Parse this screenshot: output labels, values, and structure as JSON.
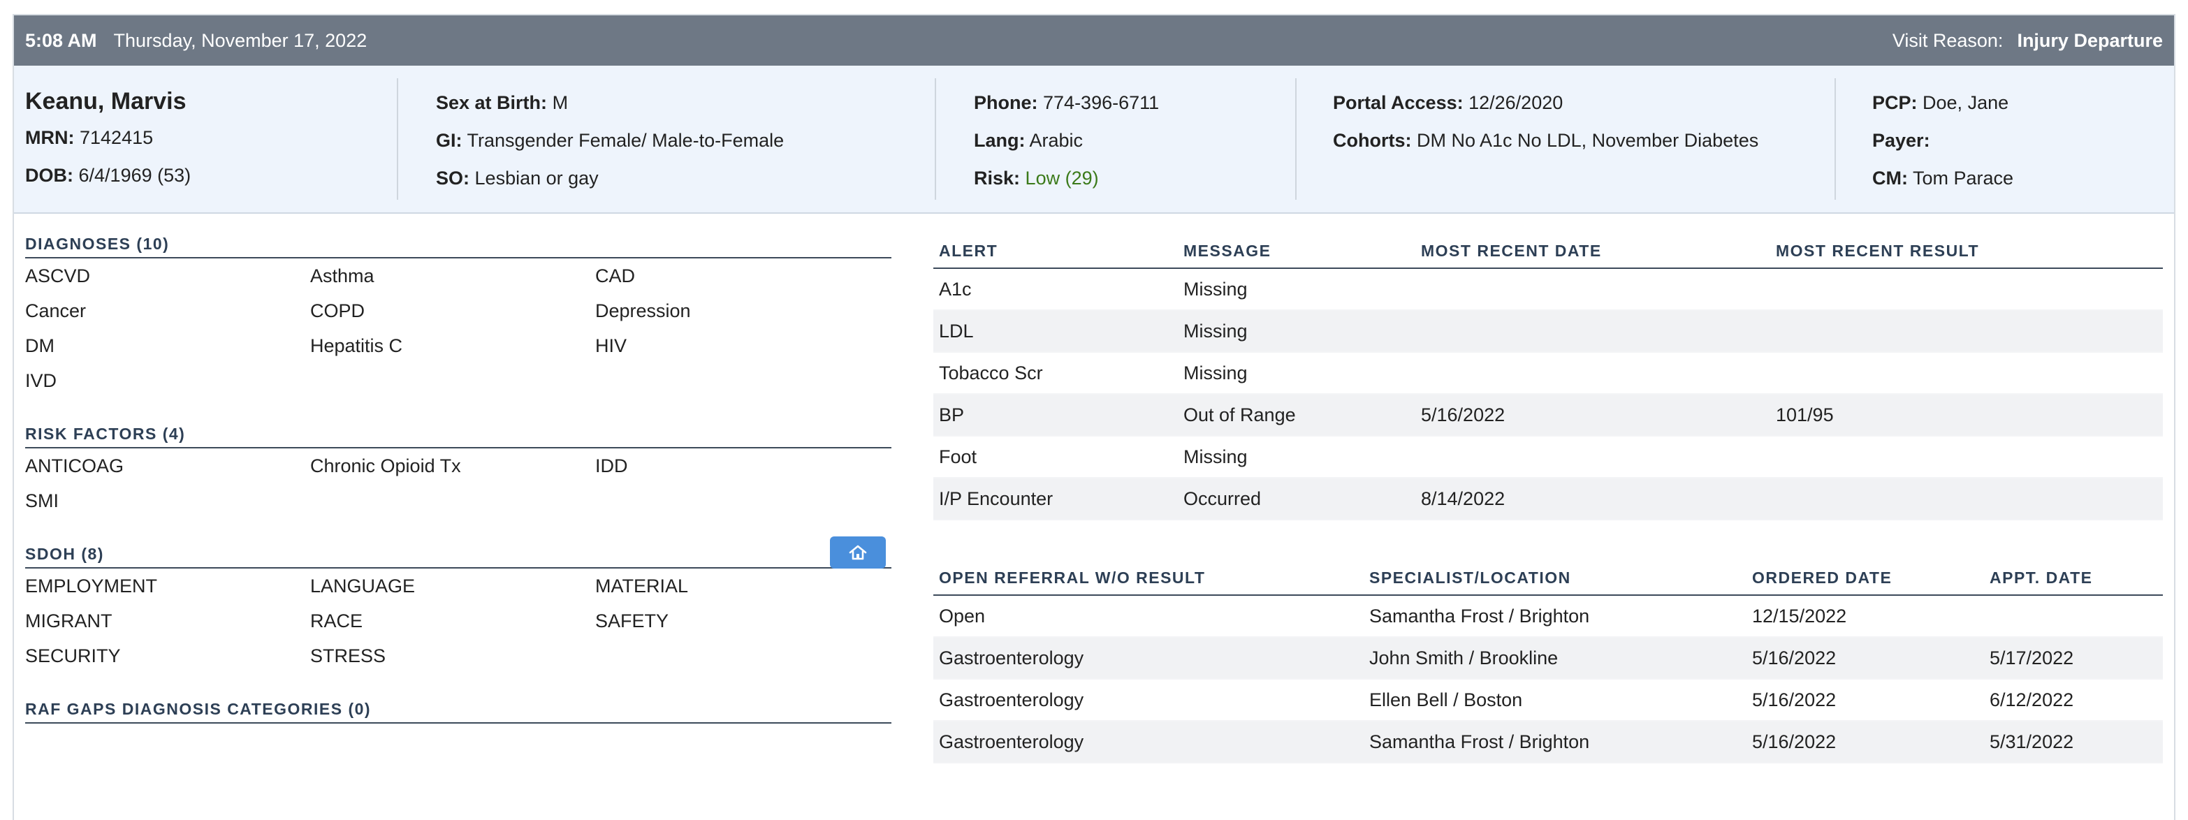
{
  "topbar": {
    "time": "5:08 AM",
    "date": "Thursday, November 17, 2022",
    "visit_reason_label": "Visit Reason:",
    "visit_reason": "Injury Departure"
  },
  "patient": {
    "name": "Keanu, Marvis",
    "mrn_label": "MRN:",
    "mrn": "7142415",
    "dob_label": "DOB:",
    "dob": "6/4/1969 (53)",
    "sex_label": "Sex at Birth:",
    "sex": "M",
    "gi_label": "GI:",
    "gi": "Transgender Female/ Male-to-Female",
    "so_label": "SO:",
    "so": "Lesbian or gay",
    "phone_label": "Phone:",
    "phone": "774-396-6711",
    "lang_label": "Lang:",
    "lang": "Arabic",
    "risk_label": "Risk:",
    "risk": "Low (29)",
    "portal_label": "Portal Access:",
    "portal": "12/26/2020",
    "cohorts_label": "Cohorts:",
    "cohorts": "DM No A1c No LDL, November Diabetes",
    "pcp_label": "PCP:",
    "pcp": "Doe, Jane",
    "payer_label": "Payer:",
    "payer": "",
    "cm_label": "CM:",
    "cm": "Tom Parace"
  },
  "diagnoses": {
    "title": "DIAGNOSES (10)",
    "items": [
      "ASCVD",
      "Asthma",
      "CAD",
      "Cancer",
      "COPD",
      "Depression",
      "DM",
      "Hepatitis C",
      "HIV",
      "IVD"
    ]
  },
  "risk_factors": {
    "title": "RISK FACTORS (4)",
    "items": [
      "ANTICOAG",
      "Chronic Opioid Tx",
      "IDD",
      "SMI"
    ]
  },
  "sdoh": {
    "title": "SDOH (8)",
    "items": [
      "EMPLOYMENT",
      "LANGUAGE",
      "MATERIAL",
      "MIGRANT",
      "RACE",
      "SAFETY",
      "SECURITY",
      "STRESS"
    ],
    "home_icon": "home-icon"
  },
  "raf": {
    "title": "RAF GAPS DIAGNOSIS CATEGORIES (0)"
  },
  "alerts": {
    "headers": [
      "ALERT",
      "MESSAGE",
      "MOST RECENT DATE",
      "MOST RECENT RESULT"
    ],
    "rows": [
      [
        "A1c",
        "Missing",
        "",
        ""
      ],
      [
        "LDL",
        "Missing",
        "",
        ""
      ],
      [
        "Tobacco Scr",
        "Missing",
        "",
        ""
      ],
      [
        "BP",
        "Out of Range",
        "5/16/2022",
        "101/95"
      ],
      [
        "Foot",
        "Missing",
        "",
        ""
      ],
      [
        "I/P Encounter",
        "Occurred",
        "8/14/2022",
        ""
      ]
    ]
  },
  "referrals": {
    "headers": [
      "OPEN REFERRAL W/O RESULT",
      "SPECIALIST/LOCATION",
      "ORDERED DATE",
      "APPT. DATE"
    ],
    "rows": [
      [
        "Open",
        "Samantha Frost / Brighton",
        "12/15/2022",
        ""
      ],
      [
        "Gastroenterology",
        "John Smith / Brookline",
        "5/16/2022",
        "5/17/2022"
      ],
      [
        "Gastroenterology",
        "Ellen Bell / Boston",
        "5/16/2022",
        "6/12/2022"
      ],
      [
        "Gastroenterology",
        "Samantha Frost / Brighton",
        "5/16/2022",
        "5/31/2022"
      ]
    ]
  },
  "colors": {
    "topbar": "#6e7885",
    "banner": "#eef4fc",
    "risk_low": "#3b7a1a",
    "button": "#4a8fdc"
  }
}
